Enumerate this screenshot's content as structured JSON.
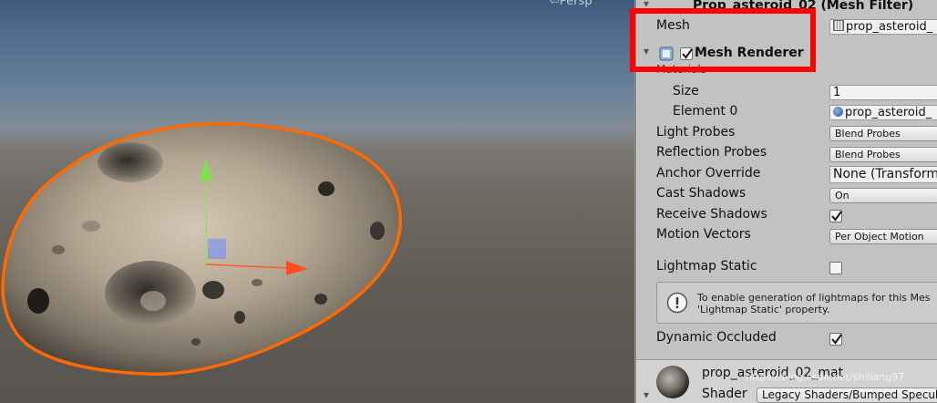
{
  "scene": {
    "persp_label": "⇦Persp"
  },
  "inspector": {
    "mesh_filter_header": "Prop_asteroid_02 (Mesh Filter)",
    "mesh_label": "Mesh",
    "mesh_value": "prop_asteroid_",
    "mesh_renderer_header": "Mesh Renderer",
    "mesh_renderer_enabled": true,
    "materials_label": "Materials",
    "size_label": "Size",
    "size_value": "1",
    "element0_label": "Element 0",
    "element0_value": "prop_asteroid_",
    "light_probes_label": "Light Probes",
    "light_probes_value": "Blend Probes",
    "reflection_probes_label": "Reflection Probes",
    "reflection_probes_value": "Blend Probes",
    "anchor_override_label": "Anchor Override",
    "anchor_override_value": "None (Transform",
    "cast_shadows_label": "Cast Shadows",
    "cast_shadows_value": "On",
    "receive_shadows_label": "Receive Shadows",
    "receive_shadows_checked": true,
    "motion_vectors_label": "Motion Vectors",
    "motion_vectors_value": "Per Object Motion",
    "lightmap_static_label": "Lightmap Static",
    "lightmap_static_checked": false,
    "help_line1": "To enable generation of lightmaps for this Mes",
    "help_line2": "'Lightmap Static' property.",
    "dynamic_occluded_label": "Dynamic Occluded",
    "dynamic_occluded_checked": true,
    "material_name": "prop_asteroid_02_mat",
    "shader_label": "Shader",
    "shader_value": "Legacy Shaders/Bumped Specula",
    "watermark": "https://blog.csdn.net/shiliang97"
  },
  "colors": {
    "highlight": "#ff0000",
    "selection_outline": "#ff6a00",
    "gizmo_x": "#ff4b1f",
    "gizmo_y": "#7ee04a",
    "gizmo_z": "#4a78ff"
  }
}
